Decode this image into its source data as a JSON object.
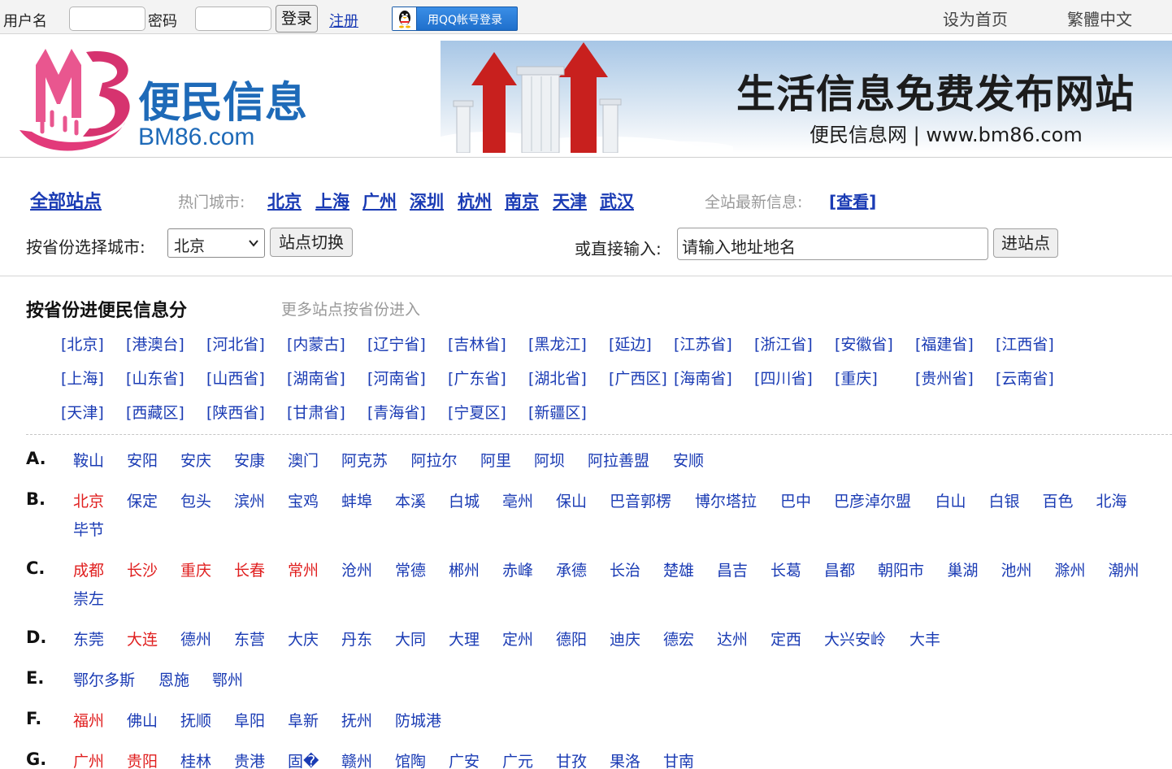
{
  "topbar": {
    "username_label": "用户名",
    "password_label": "密码",
    "login_label": "登录",
    "register_label": "注册",
    "qq_login_label": "用QQ帐号登录",
    "set_home_label": "设为首页",
    "traditional_label": "繁體中文"
  },
  "header": {
    "logo_text_cn": "便民信息",
    "logo_text_en": "BM86.com",
    "banner_title": "生活信息免费发布网站",
    "banner_subtitle": "便民信息网 | www.bm86.com"
  },
  "nav": {
    "all_sites": "全部站点",
    "hot_label": "热门城市:",
    "hot_cities": [
      "北京",
      "上海",
      "广州",
      "深圳",
      "杭州",
      "南京",
      "天津",
      "武汉"
    ],
    "latest_label": "全站最新信息:",
    "latest_link": "[查看]",
    "province_select_label": "按省份选择城市:",
    "province_selected": "北京",
    "switch_button": "站点切换",
    "direct_label": "或直接输入:",
    "address_placeholder": "请输入地址地名",
    "go_button": "进站点"
  },
  "provinces": {
    "heading": "按省份进便民信息分",
    "more": "更多站点按省份进入",
    "rows": [
      [
        "[北京]",
        "[港澳台]",
        "[河北省]",
        "[内蒙古]",
        "[辽宁省]",
        "[吉林省]",
        "[黑龙江]",
        "[延边]",
        "[江苏省]",
        "[浙江省]",
        "[安徽省]",
        "[福建省]",
        "[江西省]"
      ],
      [
        "[上海]",
        "[山东省]",
        "[山西省]",
        "[湖南省]",
        "[河南省]",
        "[广东省]",
        "[湖北省]",
        "[广西区]",
        "[海南省]",
        "[四川省]",
        "[重庆]",
        "[贵州省]",
        "[云南省]"
      ],
      [
        "[天津]",
        "[西藏区]",
        "[陕西省]",
        "[甘肃省]",
        "[青海省]",
        "[宁夏区]",
        "[新疆区]"
      ]
    ]
  },
  "cities": [
    {
      "letter": "A.",
      "items": [
        {
          "name": "鞍山"
        },
        {
          "name": "安阳"
        },
        {
          "name": "安庆"
        },
        {
          "name": "安康"
        },
        {
          "name": "澳门"
        },
        {
          "name": "阿克苏"
        },
        {
          "name": "阿拉尔"
        },
        {
          "name": "阿里"
        },
        {
          "name": "阿坝"
        },
        {
          "name": "阿拉善盟"
        },
        {
          "name": "安顺"
        }
      ]
    },
    {
      "letter": "B.",
      "items": [
        {
          "name": "北京",
          "hot": true
        },
        {
          "name": "保定"
        },
        {
          "name": "包头"
        },
        {
          "name": "滨州"
        },
        {
          "name": "宝鸡"
        },
        {
          "name": "蚌埠"
        },
        {
          "name": "本溪"
        },
        {
          "name": "白城"
        },
        {
          "name": "亳州"
        },
        {
          "name": "保山"
        },
        {
          "name": "巴音郭楞"
        },
        {
          "name": "博尔塔拉"
        },
        {
          "name": "巴中"
        },
        {
          "name": "巴彦淖尔盟"
        },
        {
          "name": "白山"
        },
        {
          "name": "白银"
        },
        {
          "name": "百色"
        },
        {
          "name": "北海"
        },
        {
          "name": "毕节"
        }
      ]
    },
    {
      "letter": "C.",
      "items": [
        {
          "name": "成都",
          "hot": true
        },
        {
          "name": "长沙",
          "hot": true
        },
        {
          "name": "重庆",
          "hot": true
        },
        {
          "name": "长春",
          "hot": true
        },
        {
          "name": "常州",
          "hot": true
        },
        {
          "name": "沧州"
        },
        {
          "name": "常德"
        },
        {
          "name": "郴州"
        },
        {
          "name": "赤峰"
        },
        {
          "name": "承德"
        },
        {
          "name": "长治"
        },
        {
          "name": "楚雄"
        },
        {
          "name": "昌吉"
        },
        {
          "name": "长葛"
        },
        {
          "name": "昌都"
        },
        {
          "name": "朝阳市"
        },
        {
          "name": "巢湖"
        },
        {
          "name": "池州"
        },
        {
          "name": "滁州"
        },
        {
          "name": "潮州"
        },
        {
          "name": "崇左"
        }
      ]
    },
    {
      "letter": "D.",
      "items": [
        {
          "name": "东莞"
        },
        {
          "name": "大连",
          "hot": true
        },
        {
          "name": "德州"
        },
        {
          "name": "东营"
        },
        {
          "name": "大庆"
        },
        {
          "name": "丹东"
        },
        {
          "name": "大同"
        },
        {
          "name": "大理"
        },
        {
          "name": "定州"
        },
        {
          "name": "德阳"
        },
        {
          "name": "迪庆"
        },
        {
          "name": "德宏"
        },
        {
          "name": "达州"
        },
        {
          "name": "定西"
        },
        {
          "name": "大兴安岭"
        },
        {
          "name": "大丰"
        }
      ]
    },
    {
      "letter": "E.",
      "items": [
        {
          "name": "鄂尔多斯"
        },
        {
          "name": "恩施"
        },
        {
          "name": "鄂州"
        }
      ]
    },
    {
      "letter": "F.",
      "items": [
        {
          "name": "福州",
          "hot": true
        },
        {
          "name": "佛山"
        },
        {
          "name": "抚顺"
        },
        {
          "name": "阜阳"
        },
        {
          "name": "阜新"
        },
        {
          "name": "抚州"
        },
        {
          "name": "防城港"
        }
      ]
    },
    {
      "letter": "G.",
      "items": [
        {
          "name": "广州",
          "hot": true
        },
        {
          "name": "贵阳",
          "hot": true
        },
        {
          "name": "桂林"
        },
        {
          "name": "贵港"
        },
        {
          "name": "固�"
        },
        {
          "name": "赣州"
        },
        {
          "name": "馆陶"
        },
        {
          "name": "广安"
        },
        {
          "name": "广元"
        },
        {
          "name": "甘孜"
        },
        {
          "name": "果洛"
        },
        {
          "name": "甘南"
        }
      ]
    }
  ],
  "colors": {
    "link_blue": "#1a3bb4",
    "hot_red": "#e02020",
    "logo_pink": "#e23a7a",
    "logo_blue": "#1e6ab8"
  }
}
